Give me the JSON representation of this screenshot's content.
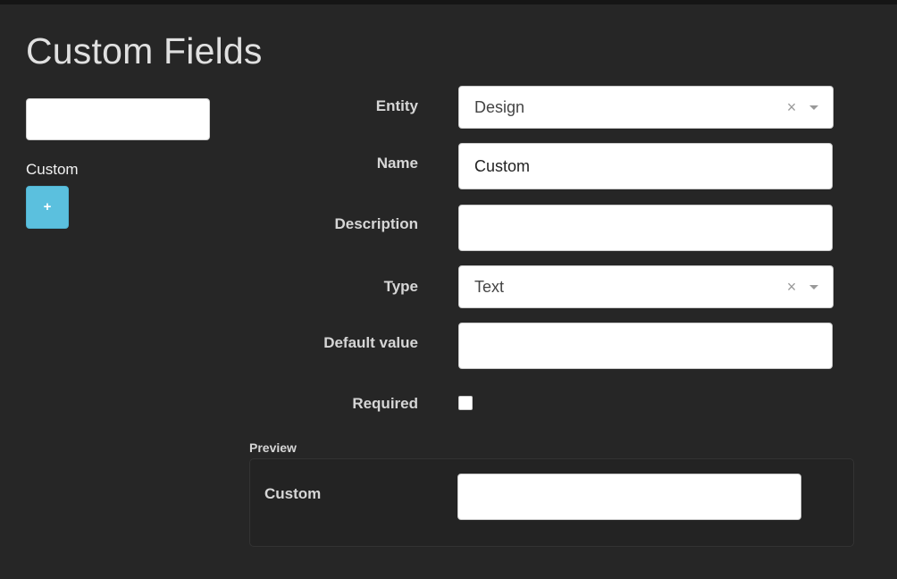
{
  "page": {
    "title": "Custom Fields"
  },
  "sidebar": {
    "search_value": "",
    "items": [
      {
        "label": "Custom"
      }
    ],
    "add_label": "+"
  },
  "form": {
    "entity": {
      "label": "Entity",
      "value": "Design",
      "clear_glyph": "×"
    },
    "name": {
      "label": "Name",
      "value": "Custom"
    },
    "description": {
      "label": "Description",
      "value": ""
    },
    "type": {
      "label": "Type",
      "value": "Text",
      "clear_glyph": "×"
    },
    "default_value": {
      "label": "Default value",
      "value": ""
    },
    "required": {
      "label": "Required",
      "checked": false
    }
  },
  "preview": {
    "heading": "Preview",
    "field_label": "Custom",
    "field_value": ""
  },
  "colors": {
    "background": "#262626",
    "accent_button": "#5bc0de",
    "label_text": "#d6d6d6"
  }
}
